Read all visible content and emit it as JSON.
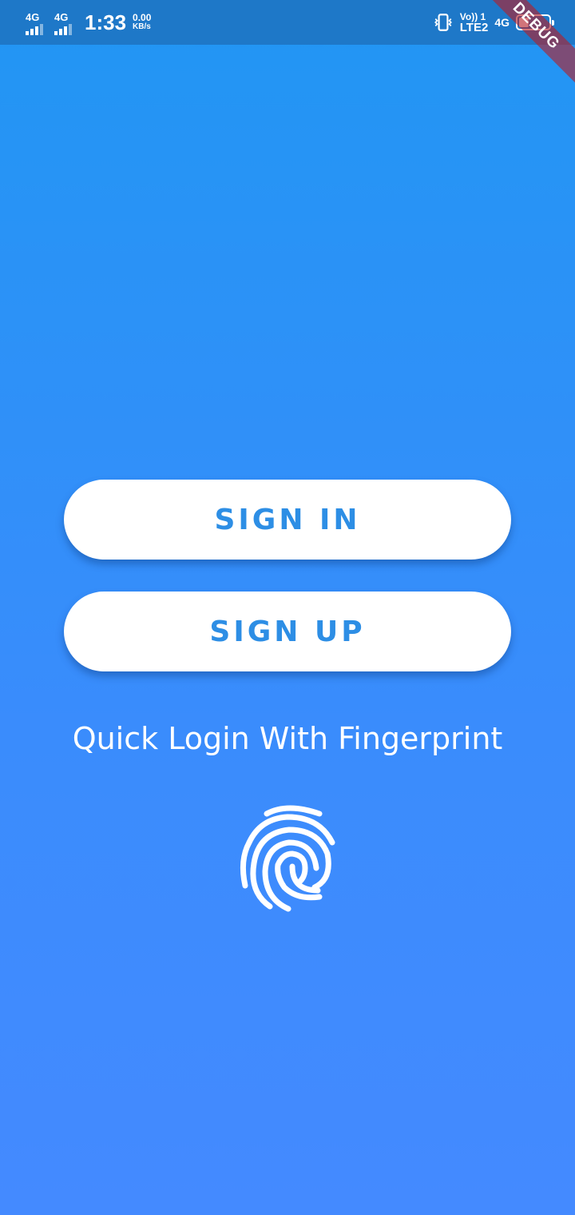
{
  "status_bar": {
    "sim1_network": "4G",
    "sim2_network": "4G",
    "time": "1:33",
    "speed_value": "0.00",
    "speed_unit": "KB/s",
    "volte_label": "Vo)) 1",
    "lte_label": "LTE2",
    "data_network": "4G",
    "battery_level": "34",
    "battery_fraction": 0.34
  },
  "debug_banner": "DEBUG",
  "buttons": {
    "sign_in": "SIGN IN",
    "sign_up": "SIGN UP"
  },
  "quick_login": {
    "label": "Quick Login With Fingerprint",
    "icon": "fingerprint-icon"
  },
  "colors": {
    "status_bar_bg": "#1e78c8",
    "gradient_top": "#2196f3",
    "gradient_bottom": "#448aff",
    "button_bg": "#ffffff",
    "button_text": "#2d8ee5",
    "debug_ribbon": "#b41e28"
  }
}
